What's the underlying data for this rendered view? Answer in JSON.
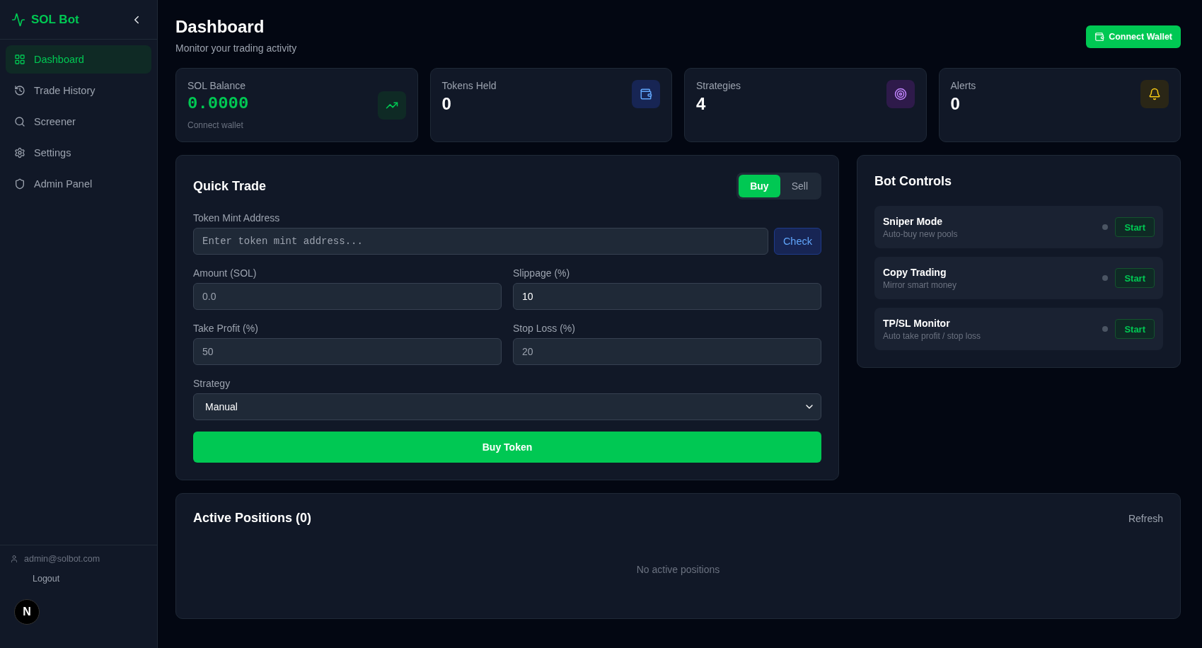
{
  "sidebar": {
    "brand": "SOL Bot",
    "items": [
      {
        "label": "Dashboard",
        "selected": true,
        "kind": "grid"
      },
      {
        "label": "Trade History",
        "selected": false,
        "kind": "history"
      },
      {
        "label": "Screener",
        "selected": false,
        "kind": "search"
      },
      {
        "label": "Settings",
        "selected": false,
        "kind": "settings"
      },
      {
        "label": "Admin Panel",
        "selected": false,
        "kind": "shield"
      }
    ],
    "user_email": "admin@solbot.com",
    "logout": "Logout"
  },
  "header": {
    "title": "Dashboard",
    "subtitle": "Monitor your trading activity",
    "connect_wallet": "Connect Wallet"
  },
  "stats": [
    {
      "kind": "balance",
      "label": "SOL Balance",
      "value": "0.0000",
      "note": "Connect wallet"
    },
    {
      "kind": "tokens",
      "label": "Tokens Held",
      "value": "0"
    },
    {
      "kind": "strategies",
      "label": "Strategies",
      "value": "4"
    },
    {
      "kind": "alerts",
      "label": "Alerts",
      "value": "0"
    }
  ],
  "quick_trade": {
    "title": "Quick Trade",
    "modes": [
      {
        "label": "Buy",
        "selected": true
      },
      {
        "label": "Sell",
        "selected": false
      }
    ],
    "mint": {
      "label": "Token Mint Address",
      "placeholder": "Enter token mint address..."
    },
    "check": "Check",
    "amount": {
      "label": "Amount (SOL)",
      "placeholder": "0.0"
    },
    "slippage": {
      "label": "Slippage (%)",
      "value": "10"
    },
    "take_profit": {
      "label": "Take Profit (%)",
      "placeholder": "50"
    },
    "stop_loss": {
      "label": "Stop Loss (%)",
      "placeholder": "20"
    },
    "strategy": {
      "label": "Strategy",
      "value": "Manual"
    },
    "submit": "Buy Token"
  },
  "bot_controls": {
    "title": "Bot Controls",
    "items": [
      {
        "name": "Sniper Mode",
        "description": "Auto-buy new pools",
        "running": false,
        "button": "Start"
      },
      {
        "name": "Copy Trading",
        "description": "Mirror smart money",
        "running": false,
        "button": "Start"
      },
      {
        "name": "TP/SL Monitor",
        "description": "Auto take profit / stop loss",
        "running": false,
        "button": "Start"
      }
    ]
  },
  "positions": {
    "title": "Active Positions (0)",
    "refresh": "Refresh",
    "empty": "No active positions"
  },
  "dev_badge": "N"
}
